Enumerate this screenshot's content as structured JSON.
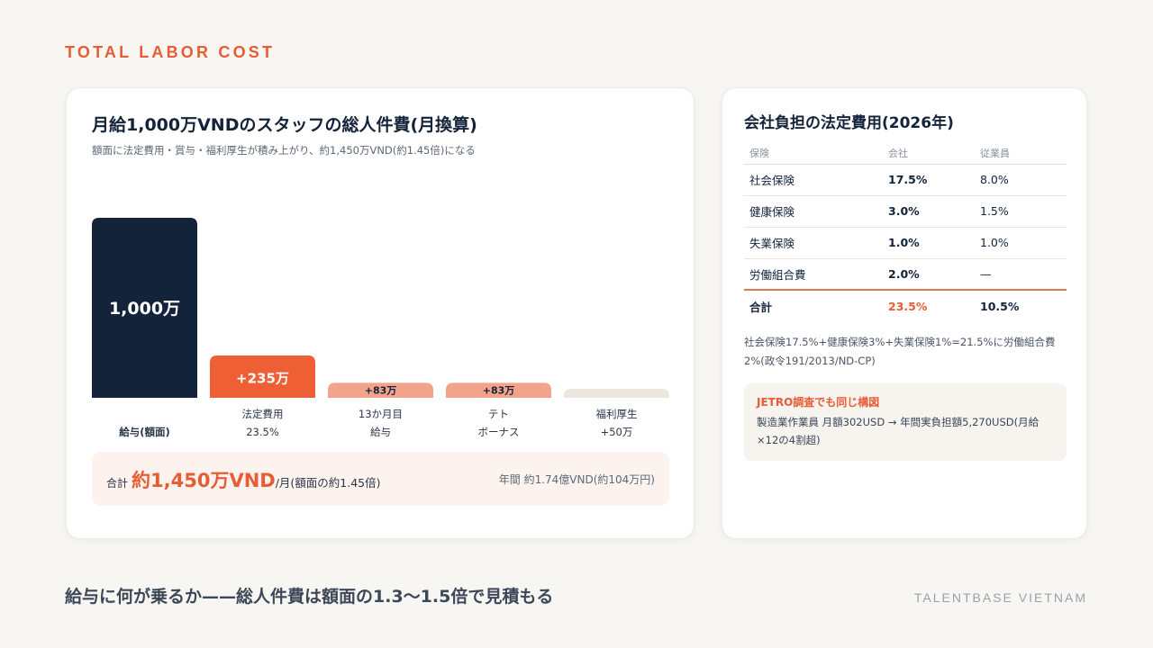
{
  "eyebrow": "TOTAL LABOR COST",
  "chart_data": {
    "type": "bar",
    "title": "月給1,000万VNDのスタッフの総人件費(月換算)",
    "subtitle": "額面に法定費用・賞与・福利厚生が積み上がり、約1,450万VND(約1.45倍)になる",
    "unit": "万VND",
    "categories": [
      {
        "line1": "給与(額面)",
        "line2": ""
      },
      {
        "line1": "法定費用",
        "line2": "23.5%"
      },
      {
        "line1": "13か月目",
        "line2": "給与"
      },
      {
        "line1": "テト",
        "line2": "ボーナス"
      },
      {
        "line1": "福利厚生",
        "line2": "+50万"
      }
    ],
    "values": [
      1000,
      235,
      83,
      83,
      50
    ],
    "labels": [
      "1,000万",
      "+235万",
      "+83万",
      "+83万",
      ""
    ],
    "colors": [
      "#13233a",
      "#ef5f35",
      "#f3a38a",
      "#f3a38a",
      "#ebe6de"
    ],
    "label_colors": [
      "#ffffff",
      "#ffffff",
      "#13233a",
      "#13233a",
      "#13233a"
    ]
  },
  "total": {
    "prefix": "合計",
    "amount": "約1,450万VND",
    "unit": "/月(額面の約1.45倍)",
    "annual": "年間 約1.74億VND(約104万円)"
  },
  "fees": {
    "title": "会社負担の法定費用(2026年)",
    "headers": [
      "保険",
      "会社",
      "従業員"
    ],
    "rows": [
      {
        "name": "社会保険",
        "company": "17.5%",
        "employee": "8.0%"
      },
      {
        "name": "健康保険",
        "company": "3.0%",
        "employee": "1.5%"
      },
      {
        "name": "失業保険",
        "company": "1.0%",
        "employee": "1.0%"
      },
      {
        "name": "労働組合費",
        "company": "2.0%",
        "employee": "—"
      }
    ],
    "total": {
      "name": "合計",
      "company": "23.5%",
      "employee": "10.5%"
    },
    "note": "社会保険17.5%+健康保険3%+失業保険1%=21.5%に労働組合費2%(政令191/2013/ND-CP)",
    "callout_title": "JETRO調査でも同じ構図",
    "callout_body": "製造業作業員 月額302USD → 年間実負担額5,270USD(月給×12の4割超)"
  },
  "footer": {
    "message": "給与に何が乗るか——総人件費は額面の1.3〜1.5倍で見積もる",
    "brand": "TALENTBASE VIETNAM"
  }
}
